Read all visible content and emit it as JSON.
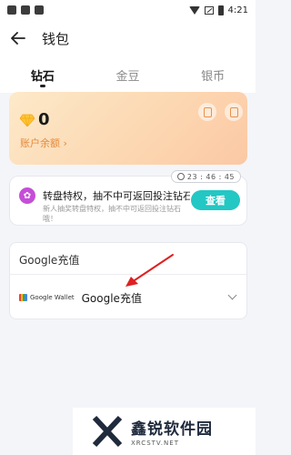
{
  "status_bar": {
    "time": "4:21"
  },
  "header": {
    "back_icon": "arrow-left-icon",
    "title": "钱包"
  },
  "tabs": [
    {
      "label": "钻石",
      "active": true
    },
    {
      "label": "金豆",
      "active": false
    },
    {
      "label": "银币",
      "active": false
    }
  ],
  "balance": {
    "icon": "diamond-icon",
    "value": "0",
    "label": "账户余额",
    "label_chevron": "›",
    "icons": [
      "bill-icon",
      "record-icon"
    ]
  },
  "promo": {
    "countdown": "23 : 46 : 45",
    "title": "转盘特权，抽不中可返回投注钻石！",
    "subtitle": "新人抽奖转盘特权，抽不中可返回投注钻石哦！",
    "button": "查看"
  },
  "recharge": {
    "title": "Google充值",
    "method_logo_text": "Google Wallet",
    "method_label": "Google充值"
  },
  "watermark": {
    "main": "鑫锐软件园",
    "sub": "XRCSTV.NET"
  },
  "colors": {
    "accent_teal": "#23c7c3",
    "balance_label": "#e38a3c",
    "annotation_red": "#e02020"
  }
}
